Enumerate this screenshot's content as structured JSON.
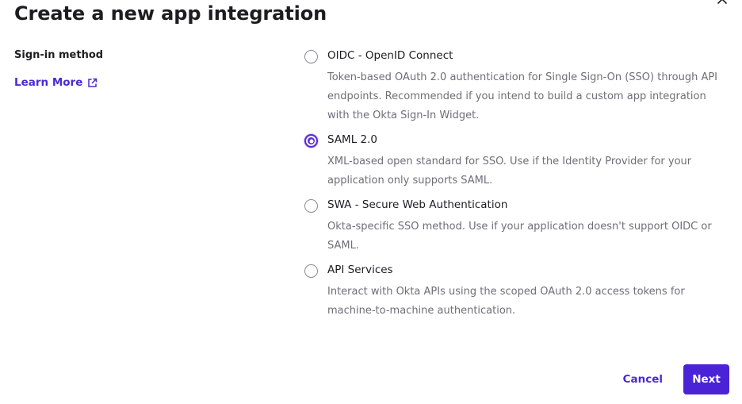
{
  "dialog": {
    "title": "Create a new app integration",
    "close_icon": "close-icon"
  },
  "sign_in": {
    "label": "Sign-in method",
    "learn_more": "Learn More",
    "learn_more_icon": "external-link-icon"
  },
  "options": [
    {
      "label": "OIDC - OpenID Connect",
      "description": "Token-based OAuth 2.0 authentication for Single Sign-On (SSO) through API endpoints. Recommended if you intend to build a custom app integration with the Okta Sign-In Widget.",
      "selected": false
    },
    {
      "label": "SAML 2.0",
      "description": "XML-based open standard for SSO. Use if the Identity Provider for your application only supports SAML.",
      "selected": true
    },
    {
      "label": "SWA - Secure Web Authentication",
      "description": "Okta-specific SSO method. Use if your application doesn't support OIDC or SAML.",
      "selected": false
    },
    {
      "label": "API Services",
      "description": "Interact with Okta APIs using the scoped OAuth 2.0 access tokens for machine-to-machine authentication.",
      "selected": false
    }
  ],
  "footer": {
    "cancel_label": "Cancel",
    "next_label": "Next"
  },
  "colors": {
    "accent": "#4b23d6",
    "link": "#4b2ad1",
    "text": "#1d1d21",
    "muted": "#6e6e78"
  }
}
